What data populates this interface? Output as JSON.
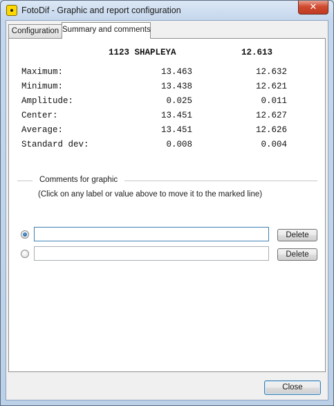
{
  "window": {
    "title": "FotoDif - Graphic and report configuration",
    "close_glyph": "✕",
    "icon": "app-icon"
  },
  "tabs": [
    {
      "label": "Configuration",
      "active": false
    },
    {
      "label": "Summary and comments",
      "active": true
    }
  ],
  "summary": {
    "header": {
      "name": "1123 SHAPLEYA",
      "value": "12.613"
    },
    "rows": [
      {
        "label": "Maximum:",
        "v1": "13.463",
        "v2": "12.632"
      },
      {
        "label": "Minimum:",
        "v1": "13.438",
        "v2": "12.621"
      },
      {
        "label": "Amplitude:",
        "v1": "0.025",
        "v2": "0.011"
      },
      {
        "label": "Center:",
        "v1": "13.451",
        "v2": "12.627"
      },
      {
        "label": "Average:",
        "v1": "13.451",
        "v2": "12.626"
      },
      {
        "label": "Standard dev:",
        "v1": "0.008",
        "v2": "0.004"
      }
    ]
  },
  "comments": {
    "group_title": "Comments for graphic",
    "hint": "(Click on any label or value above to move it to the marked line)",
    "lines": [
      {
        "value": "",
        "selected": true,
        "delete_label": "Delete"
      },
      {
        "value": "",
        "selected": false,
        "delete_label": "Delete"
      }
    ]
  },
  "footer": {
    "close_label": "Close"
  }
}
